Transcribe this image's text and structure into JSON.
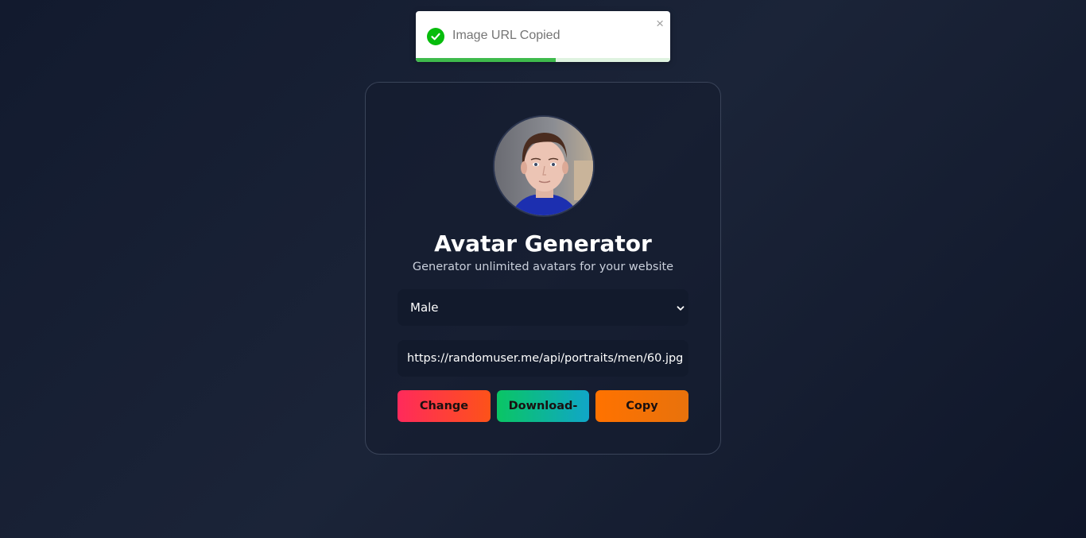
{
  "toast": {
    "message": "Image URL Copied",
    "close_glyph": "×",
    "progress": 0.55,
    "icon": "check-circle-icon",
    "accent_color": "#07bc0c"
  },
  "card": {
    "avatar_alt": "avatar",
    "title": "Avatar Generator",
    "subtitle": "Generator unlimited avatars for your website",
    "gender_select": {
      "value": "Male",
      "icon": "chevron-down-icon"
    },
    "url_value": "https://randomuser.me/api/portraits/men/60.jpg",
    "buttons": {
      "change": "Change",
      "download": "Download-",
      "copy": "Copy"
    }
  }
}
